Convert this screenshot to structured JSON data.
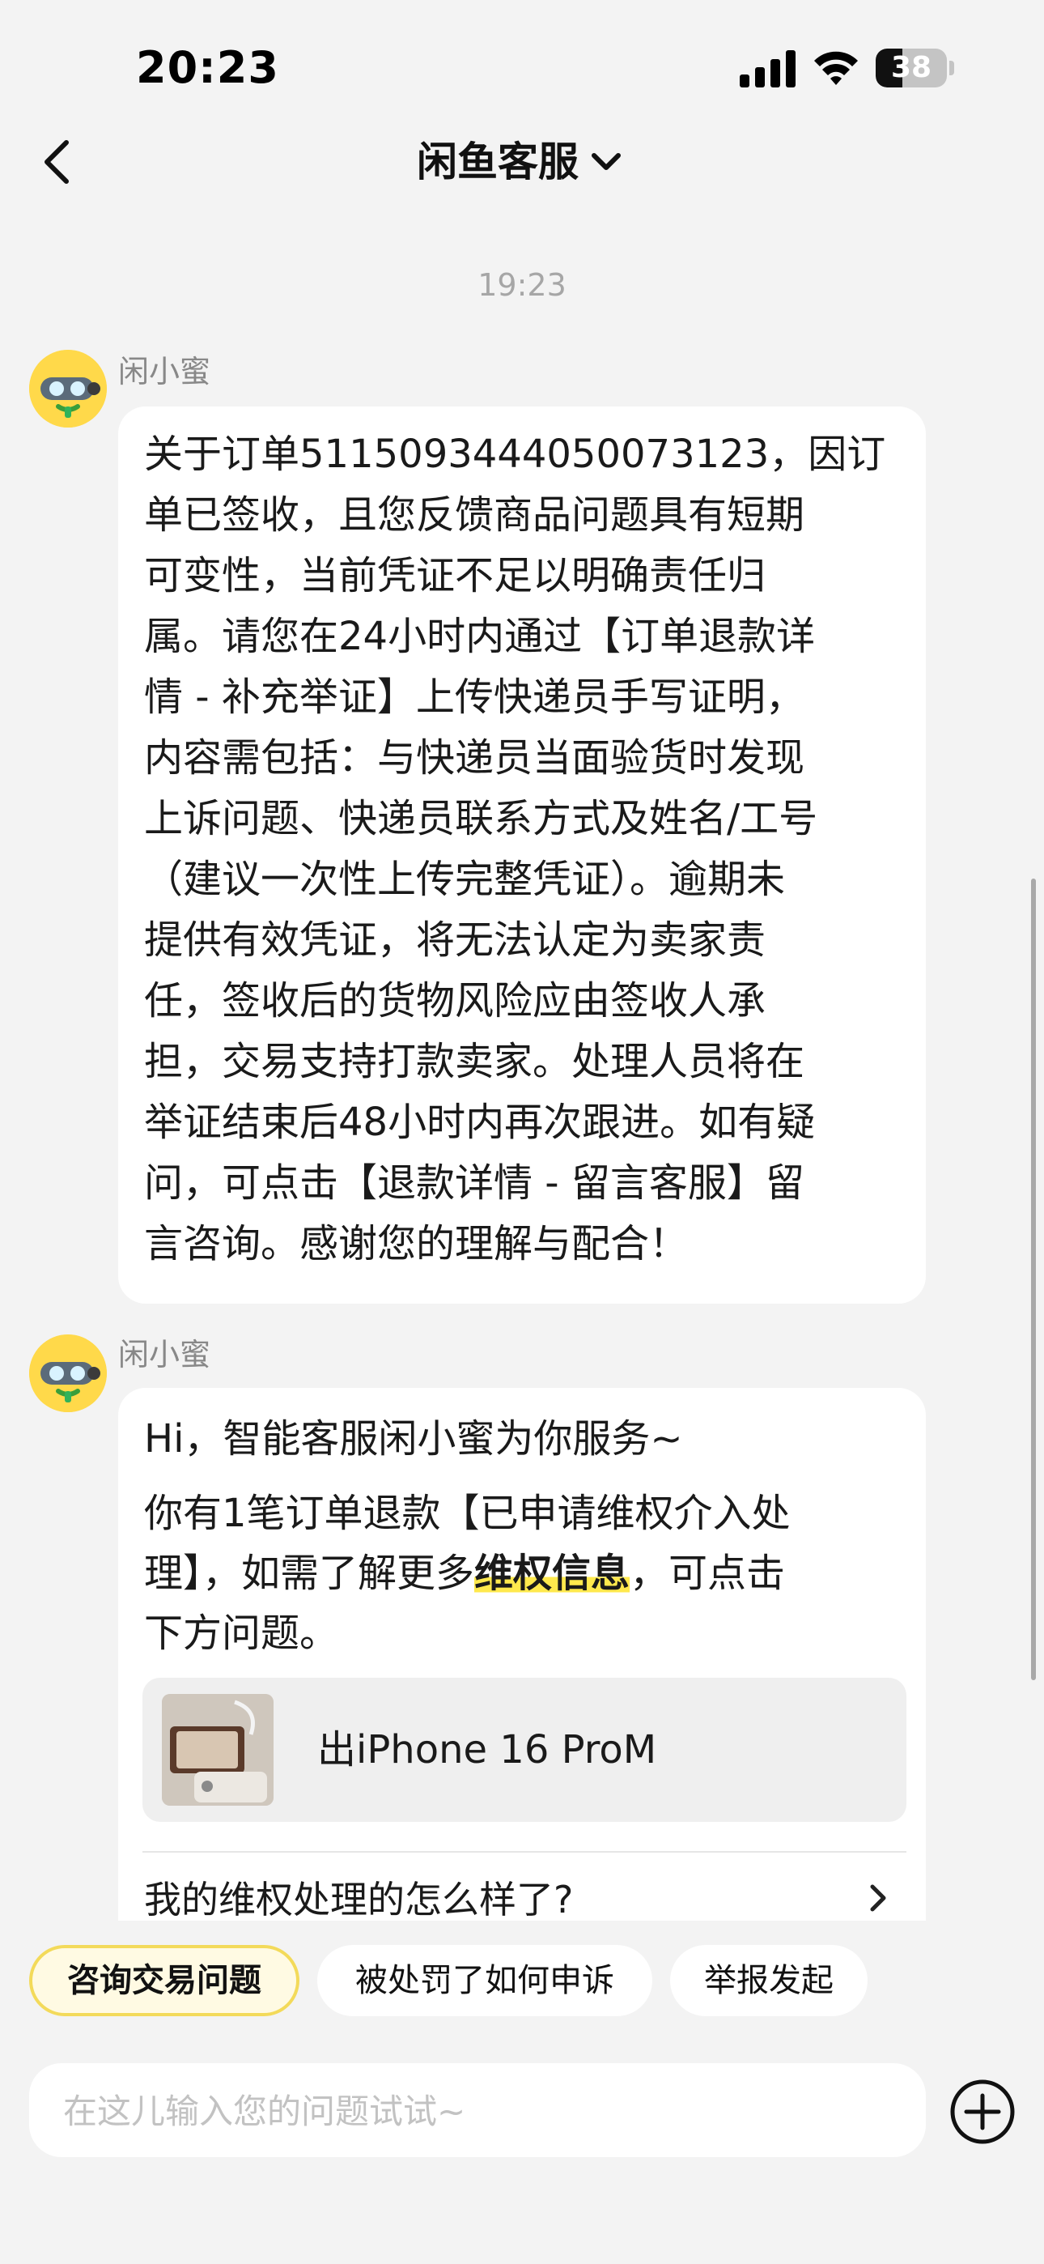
{
  "status_bar": {
    "time": "20:23",
    "battery": "38",
    "battery_level": 0.38
  },
  "nav": {
    "title": "闲鱼客服"
  },
  "chat": {
    "timestamp": "19:23",
    "messages": [
      {
        "sender": "闲小蜜",
        "lines": [
          "关于订单5115093444050073123，因订",
          "单已签收，且您反馈商品问题具有短期",
          "可变性，当前凭证不足以明确责任归",
          "属。请您在24小时内通过【订单退款详",
          "情 - 补充举证】上传快递员手写证明，",
          "内容需包括：与快递员当面验货时发现",
          "上诉问题、快递员联系方式及姓名/工号",
          "（建议一次性上传完整凭证）。逾期未",
          "提供有效凭证，将无法认定为卖家责",
          "任，签收后的货物风险应由签收人承",
          "担，交易支持打款卖家。处理人员将在",
          "举证结束后48小时内再次跟进。如有疑",
          "问，可点击【退款详情 - 留言客服】留",
          "言咨询。感谢您的理解与配合！"
        ]
      },
      {
        "sender": "闲小蜜",
        "greeting": "Hi，智能客服闲小蜜为你服务~",
        "p2_line1": "你有1笔订单退款【已申请维权介入处",
        "p2_line2_before": "理】，如需了解更多",
        "p2_highlight": "维权信息",
        "p2_line2_after": "，可点击",
        "p2_line3": "下方问题。",
        "product_name": "出iPhone 16 ProM",
        "faq": "我的维权处理的怎么样了?"
      }
    ]
  },
  "quick_replies": [
    "咨询交易问题",
    "被处罚了如何申诉",
    "举报发起"
  ],
  "input": {
    "placeholder": "在这儿输入您的问题试试~"
  },
  "colors": {
    "accent": "#f3da5a",
    "highlight": "#ffe94d",
    "background": "#f3f3f3"
  }
}
